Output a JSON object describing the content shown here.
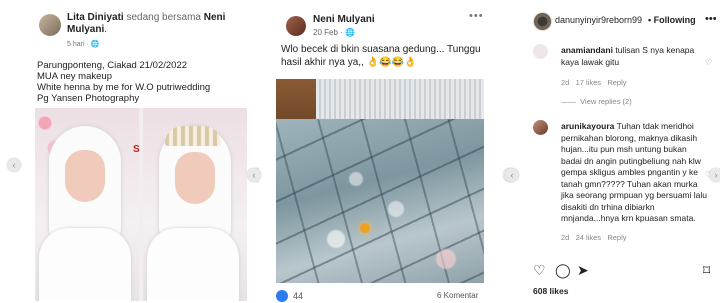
{
  "left_post": {
    "author": "Lita Diniyati",
    "with_text": "sedang bersama",
    "tagged": "Neni Mulyani",
    "time": "5 hari",
    "body": "Parungponteng, Ciakad 21/02/2022\nMUA ney makeup\nWhite henna by me for W.O putriwedding\nPg Yansen Photography",
    "watermark": "S"
  },
  "mid_post": {
    "author": "Neni Mulyani",
    "time": "20 Feb",
    "body": "Wlo becek di bkin suasana gedung... Tunggu hasil akhir nya ya,, 👌😂😂👌",
    "more": "•••",
    "reactions_count": "44",
    "comments_count": "6 Komentar"
  },
  "instagram": {
    "username": "danunyinyir9reborn99",
    "follow_label": "Following",
    "more_label": "•••",
    "comments": [
      {
        "user": "anamiandani",
        "text": "tulisan S nya kenapa kaya lawak gitu",
        "age": "2d",
        "likes": "17 likes",
        "reply": "Reply",
        "view_replies": "View replies (2)"
      },
      {
        "user": "arunikayoura",
        "text": "Tuhan tdak meridhoi pernikahan blorong, maknya dikasih hujan...itu pun msh untung bukan badai dn angin putingbeliung nah klw gempa skligus ambles pngantin y ke tanah gmn????? Tuhan akan murka jika seorang prmpuan yg bersuami lalu disakiti dn trhina dibiarkn mnjanda...hnya krn kpuasan smata.",
        "age": "2d",
        "likes": "24 likes",
        "reply": "Reply"
      }
    ],
    "likes_total": "608 likes",
    "icons": [
      "heart-icon",
      "comment-icon",
      "share-icon",
      "bookmark-icon"
    ]
  },
  "arrows": [
    "‹",
    "›",
    "‹",
    "›",
    "‹",
    "›"
  ]
}
